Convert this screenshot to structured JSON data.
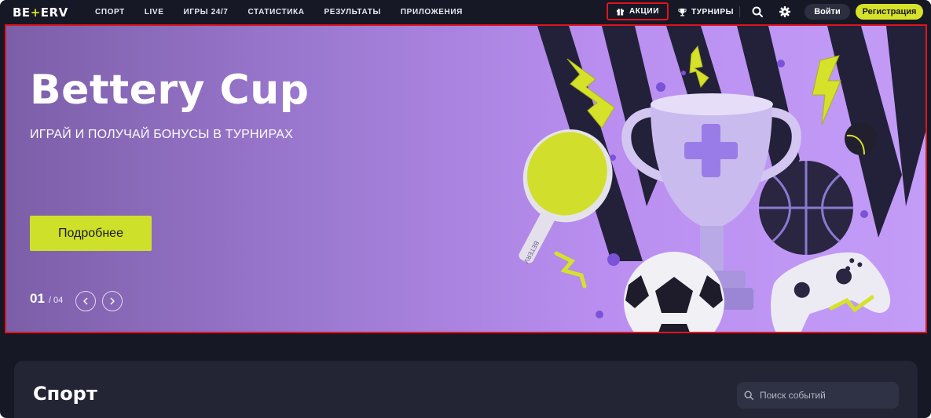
{
  "header": {
    "logo_left": "BE",
    "logo_mid": "+",
    "logo_right": "ERV",
    "nav": [
      "СПОРТ",
      "LIVE",
      "ИГРЫ 24/7",
      "СТАТИСТИКА",
      "РЕЗУЛЬТАТЫ",
      "ПРИЛОЖЕНИЯ"
    ],
    "promo_label": "АКЦИИ",
    "tournaments_label": "ТУРНИРЫ",
    "login_label": "Войти",
    "register_label": "Регистрация"
  },
  "banner": {
    "title": "Bettery Cup",
    "subtitle": "ИГРАЙ И ПОЛУЧАЙ БОНУСЫ В ТУРНИРАХ",
    "button_label": "Подробнее",
    "slide_current": "01",
    "slide_total": "/ 04",
    "paddle_text": "BETERV"
  },
  "sport": {
    "title": "Спорт",
    "search_placeholder": "Поиск событий"
  },
  "colors": {
    "accent": "#d6e22a",
    "highlight_border": "#e0141d",
    "background": "#161826"
  },
  "icons": [
    "gift-icon",
    "trophy-icon",
    "search-icon",
    "gear-icon",
    "chevron-left-icon",
    "chevron-right-icon"
  ]
}
